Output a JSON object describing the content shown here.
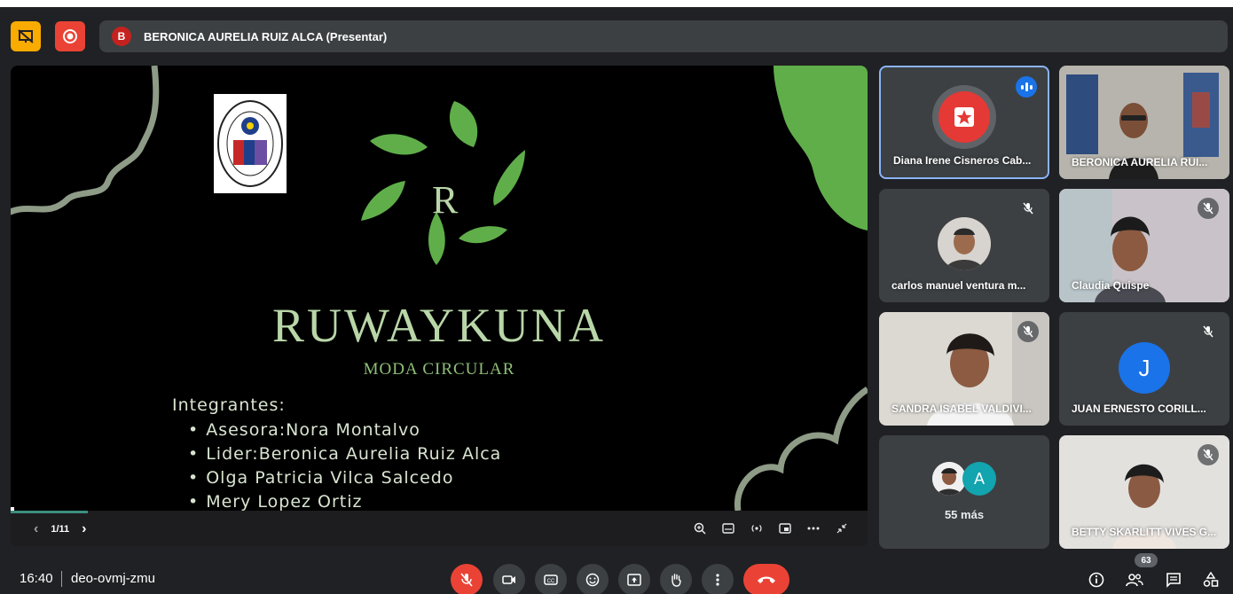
{
  "topbar": {
    "presenter_initial": "B",
    "presenter_label": "BERONICA AURELIA RUIZ ALCA (Presentar)"
  },
  "slide": {
    "logo_letter": "R",
    "title": "RUWAYKUNA",
    "subtitle": "MODA CIRCULAR",
    "members_heading": "Integrantes:",
    "members": [
      "Asesora:Nora Montalvo",
      "Lider:Beronica Aurelia Ruiz Alca",
      "Olga Patricia Vilca Salcedo",
      "Mery Lopez Ortiz"
    ],
    "page_indicator": "1/11",
    "progress_fraction": 0.09
  },
  "participants": [
    {
      "name": "Diana Irene Cisneros Cab...",
      "state": "speaking"
    },
    {
      "name": "BERONICA AURELIA RUI...",
      "state": "video"
    },
    {
      "name": "carlos manuel ventura m...",
      "state": "muted"
    },
    {
      "name": "Claudia Quispe",
      "state": "muted"
    },
    {
      "name": "SANDRA ISABEL VALDIVI...",
      "state": "muted"
    },
    {
      "name": "JUAN ERNESTO CORILL...",
      "state": "muted",
      "initial": "J"
    },
    {
      "more_label": "55 más",
      "initial": "A"
    },
    {
      "name": "BETTY SKARLITT VIVES G...",
      "state": "muted"
    }
  ],
  "bottombar": {
    "time": "16:40",
    "meeting_code": "deo-ovmj-zmu",
    "participant_count": "63"
  },
  "colors": {
    "background": "#202124",
    "tile": "#3c4043",
    "accent_red": "#ea4335",
    "accent_yellow": "#f9ab00",
    "speaking_blue": "#1a73e8",
    "leaf_green": "#5fae4a"
  }
}
